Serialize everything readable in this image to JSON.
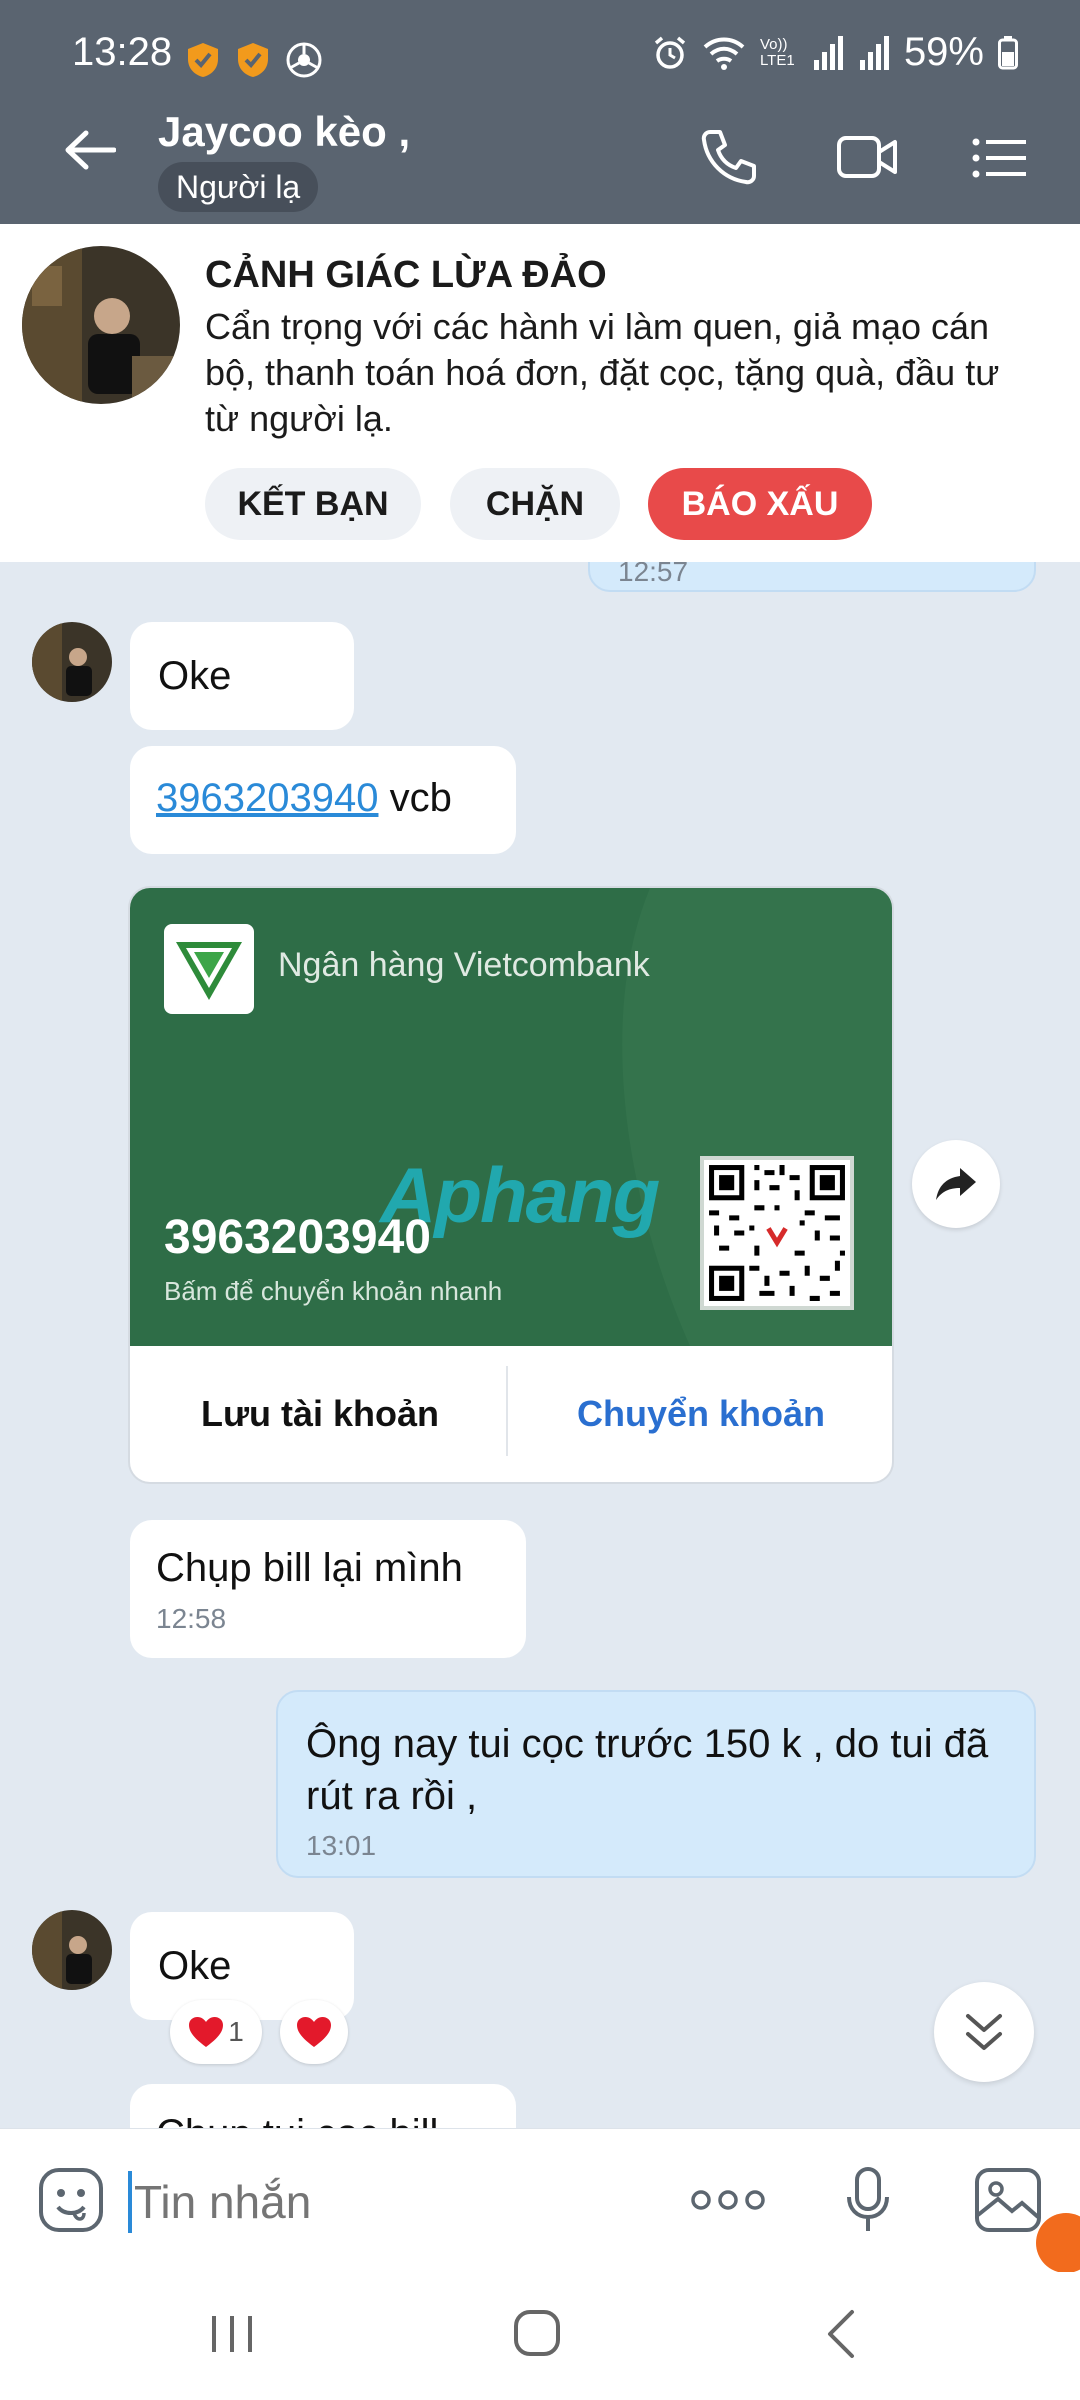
{
  "status_bar": {
    "time": "13:28",
    "battery": "59%",
    "network": "Vo)) LTE1"
  },
  "header": {
    "contact_name": "Jaycoo kèo ,",
    "tag": "Người lạ"
  },
  "warning": {
    "title": "CẢNH GIÁC LỪA ĐẢO",
    "text": "Cẩn trọng với các hành vi làm quen, giả mạo cán bộ, thanh toán hoá đơn, đặt cọc, tặng quà, đầu tư từ người lạ.",
    "buttons": {
      "add_friend": "KẾT BẠN",
      "block": "CHẶN",
      "report": "BÁO XẤU"
    }
  },
  "messages": {
    "partial_time": "12:57",
    "m1": "Oke",
    "m2_number": "3963203940",
    "m2_suffix": " vcb",
    "bank_card": {
      "bank_name": "Ngân hàng Vietcombank",
      "account_number": "3963203940",
      "hint": "Bấm để chuyển khoản nhanh",
      "watermark": "Aphang",
      "save_label": "Lưu tài khoản",
      "transfer_label": "Chuyển khoản"
    },
    "m3": {
      "text": "Chụp bill lại mình",
      "time": "12:58"
    },
    "m4": {
      "text": "Ông nay tui cọc trước 150 k , do tui đã rút ra rồi ,",
      "time": "13:01"
    },
    "m5": {
      "text": "Oke",
      "reaction_count": "1"
    },
    "m6_partial": "Chụp tui cọc bill"
  },
  "input": {
    "placeholder": "Tin nhắn"
  },
  "colors": {
    "header_bg": "#5a6470",
    "chat_bg": "#e2e9f1",
    "my_bubble": "#d4eafb",
    "report_red": "#e84a4a",
    "link_blue": "#2a8ad8",
    "bank_green": "#2e6d47"
  }
}
